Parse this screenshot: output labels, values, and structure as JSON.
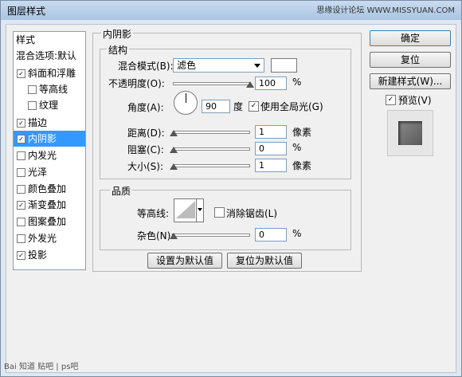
{
  "window": {
    "title": "图层样式",
    "watermark": "思缘设计论坛 WWW.MISSYUAN.COM"
  },
  "left_panel": {
    "header_styles": "样式",
    "header_blend": "混合选项:默认",
    "items": [
      {
        "label": "斜面和浮雕",
        "checked": true
      },
      {
        "label": "等高线",
        "checked": false
      },
      {
        "label": "纹理",
        "checked": false
      },
      {
        "label": "描边",
        "checked": true
      },
      {
        "label": "内阴影",
        "checked": true,
        "selected": true
      },
      {
        "label": "内发光",
        "checked": false
      },
      {
        "label": "光泽",
        "checked": false
      },
      {
        "label": "颜色叠加",
        "checked": false
      },
      {
        "label": "渐变叠加",
        "checked": true
      },
      {
        "label": "图案叠加",
        "checked": false
      },
      {
        "label": "外发光",
        "checked": false
      },
      {
        "label": "投影",
        "checked": true
      }
    ]
  },
  "inner_shadow": {
    "group_title": "内阴影",
    "structure": {
      "title": "结构",
      "blend_mode_label": "混合模式(B):",
      "blend_mode_value": "滤色",
      "opacity_label": "不透明度(O):",
      "opacity_value": "100",
      "opacity_unit": "%",
      "angle_label": "角度(A):",
      "angle_value": "90",
      "angle_unit": "度",
      "global_light_label": "使用全局光(G)",
      "global_light_checked": true,
      "distance_label": "距离(D):",
      "distance_value": "1",
      "distance_unit": "像素",
      "choke_label": "阻塞(C):",
      "choke_value": "0",
      "choke_unit": "%",
      "size_label": "大小(S):",
      "size_value": "1",
      "size_unit": "像素"
    },
    "quality": {
      "title": "品质",
      "contour_label": "等高线:",
      "antialias_label": "消除锯齿(L)",
      "antialias_checked": false,
      "noise_label": "杂色(N):",
      "noise_value": "0",
      "noise_unit": "%"
    },
    "set_default_button": "设置为默认值",
    "reset_default_button": "复位为默认值"
  },
  "right_panel": {
    "ok_button": "确定",
    "reset_button": "复位",
    "new_style_button": "新建样式(W)...",
    "preview_label": "预览(V)",
    "preview_checked": true
  },
  "footer": {
    "watermark": "Bai 知道 贴吧 | ps吧"
  },
  "colors": {
    "selection": "#3399ff",
    "blend_color": "#ffffff"
  }
}
